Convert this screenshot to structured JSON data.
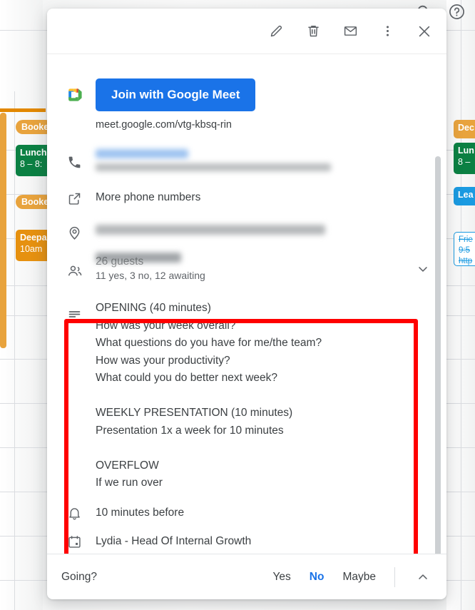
{
  "app": {
    "top_icons": [
      {
        "name": "search-icon",
        "label": "Search"
      },
      {
        "name": "help-icon",
        "label": "Support"
      }
    ]
  },
  "background_calendar": {
    "left_events": [
      {
        "title": "Booked",
        "subtitle": "",
        "color": "#e8a33d",
        "style": "pill"
      },
      {
        "title": "Lunch",
        "subtitle": "8 – 8:",
        "color": "#0b8043",
        "style": "block"
      },
      {
        "title": "Booked",
        "subtitle": "",
        "color": "#e8a33d",
        "style": "pill"
      },
      {
        "title": "Deepa",
        "subtitle": "10am",
        "color": "#e69110",
        "style": "block"
      }
    ],
    "right_events": [
      {
        "title": "Dec",
        "subtitle": "",
        "color": "#e8a33d",
        "style": "block"
      },
      {
        "title": "Lun",
        "subtitle": "8 –",
        "color": "#0b8043",
        "style": "block"
      },
      {
        "title": "Lea",
        "subtitle": "",
        "color": "#1a9ae1",
        "style": "block"
      },
      {
        "title": "Frie",
        "subtitle": "9:5",
        "subtitle2": "http",
        "color": "#1a9ae1",
        "style": "outline"
      }
    ]
  },
  "dialog": {
    "header_actions": [
      {
        "name": "edit-event-button",
        "label": "Edit event",
        "icon": "pencil-icon"
      },
      {
        "name": "delete-event-button",
        "label": "Delete event",
        "icon": "trash-icon"
      },
      {
        "name": "email-guests-button",
        "label": "Email guests",
        "icon": "envelope-icon"
      },
      {
        "name": "more-options-button",
        "label": "More options",
        "icon": "three-dots-vertical-icon"
      },
      {
        "name": "close-dialog-button",
        "label": "Close",
        "icon": "close-x-icon"
      }
    ],
    "meet": {
      "button_label": "Join with Google Meet",
      "url": "meet.google.com/vtg-kbsq-rin"
    },
    "phone": {
      "redacted": true,
      "more_numbers_label": "More phone numbers"
    },
    "location": {
      "redacted": true
    },
    "guests": {
      "count_label": "26 guests",
      "rsvp_summary": "11 yes, 3 no, 12 awaiting",
      "expand_label": "Show guest list"
    },
    "description": "OPENING (40 minutes)\nHow was your week overall?\nWhat questions do you have for me/the team?\nHow was your productivity?\nWhat could you do better next week?\n\nWEEKLY PRESENTATION (10 minutes)\nPresentation 1x a week for 10 minutes\n\nOVERFLOW\nIf we run over",
    "notification": "10 minutes before",
    "calendar_name": "Lydia - Head Of Internal Growth",
    "footer": {
      "going_label": "Going?",
      "options": [
        {
          "label": "Yes",
          "selected": false
        },
        {
          "label": "No",
          "selected": true
        },
        {
          "label": "Maybe",
          "selected": false
        }
      ],
      "expand_label": "More RSVP options"
    }
  },
  "annotation": {
    "highlight_color": "#ff0000"
  }
}
